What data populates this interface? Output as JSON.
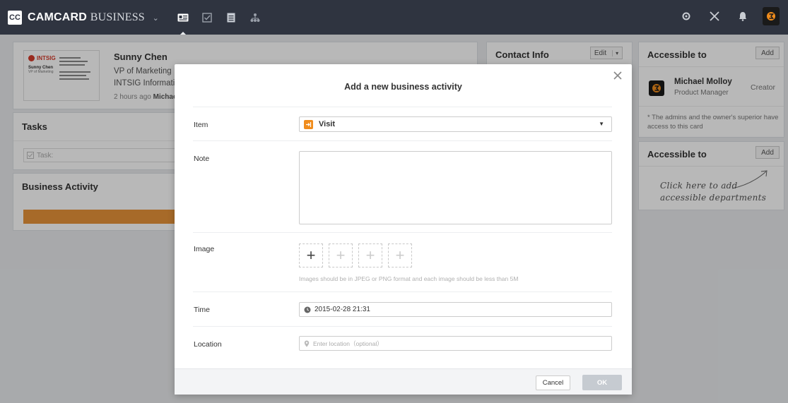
{
  "app": {
    "logo_text": "CC",
    "brand_bold": "CAMCARD",
    "brand_light": "BUSINESS",
    "brand_caret": "⌄"
  },
  "nav": {
    "icons": [
      "contacts-card-icon",
      "tasks-check-icon",
      "document-icon",
      "org-chart-icon"
    ],
    "right_icons": [
      "settings-gear-icon",
      "tools-icon",
      "notification-bell-icon",
      "user-avatar-icon"
    ]
  },
  "contact": {
    "card_thumb": {
      "brand": "INTSIG",
      "name": "Sunny Chen",
      "title": "VP of Marketing"
    },
    "name": "Sunny Chen",
    "title": "VP of Marketing",
    "company": "INTSIG Information",
    "meta_prefix": "2 hours ago",
    "meta_author": "Michael M"
  },
  "tasks": {
    "title": "Tasks",
    "input_placeholder": "Task:"
  },
  "business_activity": {
    "title": "Business Activity"
  },
  "contact_info": {
    "title": "Contact Info",
    "edit_label": "Edit",
    "edit_caret": "▾"
  },
  "accessible_users": {
    "title": "Accessible to",
    "add_label": "Add",
    "creator_name": "Michael Molloy",
    "creator_role": "Product Manager",
    "creator_tag": "Creator",
    "note": "* The admins and the owner's superior have access to this card"
  },
  "accessible_departments": {
    "title": "Accessible to",
    "add_label": "Add",
    "hint_line1": "Click here to add",
    "hint_line2": "accessible departments"
  },
  "modal": {
    "title": "Add a new business activity",
    "item_label": "Item",
    "item_value": "Visit",
    "note_label": "Note",
    "image_label": "Image",
    "image_hint": "Images should be in JPEG or PNG format and each image should be less than 5M",
    "time_label": "Time",
    "time_value": "2015-02-28 21:31",
    "location_label": "Location",
    "location_placeholder": "Enter location（optional）",
    "cancel_label": "Cancel",
    "ok_label": "OK"
  },
  "colors": {
    "topbar": "#2f3440",
    "accent_orange": "#f08c1c",
    "progress_orange": "#e8943a",
    "ok_disabled": "#c6cbd1"
  }
}
